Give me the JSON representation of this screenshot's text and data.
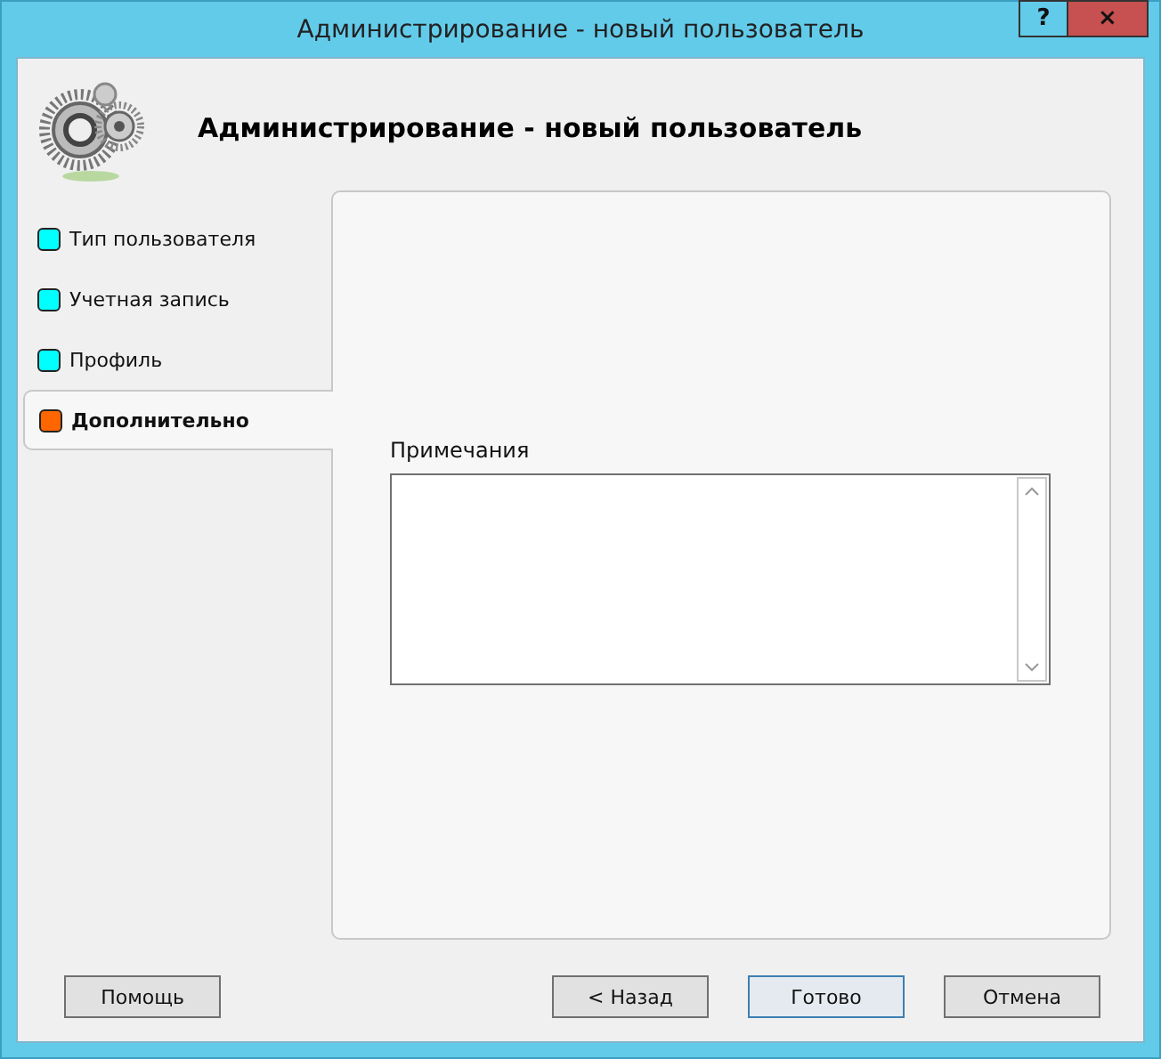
{
  "window": {
    "title": "Администрирование - новый пользователь",
    "controls": [
      "?",
      "×"
    ]
  },
  "header": {
    "title": "Администрирование - новый пользователь"
  },
  "steps": [
    {
      "label": "Тип пользователя",
      "selected": false,
      "color": "#00ffff"
    },
    {
      "label": "Учетная запись",
      "selected": false,
      "color": "#00ffff"
    },
    {
      "label": "Профиль",
      "selected": false,
      "color": "#00ffff"
    },
    {
      "label": "Дополнительно",
      "selected": true,
      "color": "#ff6600"
    }
  ],
  "notes": {
    "label": "Примечания"
  },
  "buttons": {
    "left": [
      {
        "label": "Помощь",
        "default": false
      }
    ],
    "right": [
      {
        "label": "< Назад",
        "default": false
      },
      {
        "label": "Готово",
        "default": true
      },
      {
        "label": "Отмена",
        "default": false
      }
    ]
  }
}
